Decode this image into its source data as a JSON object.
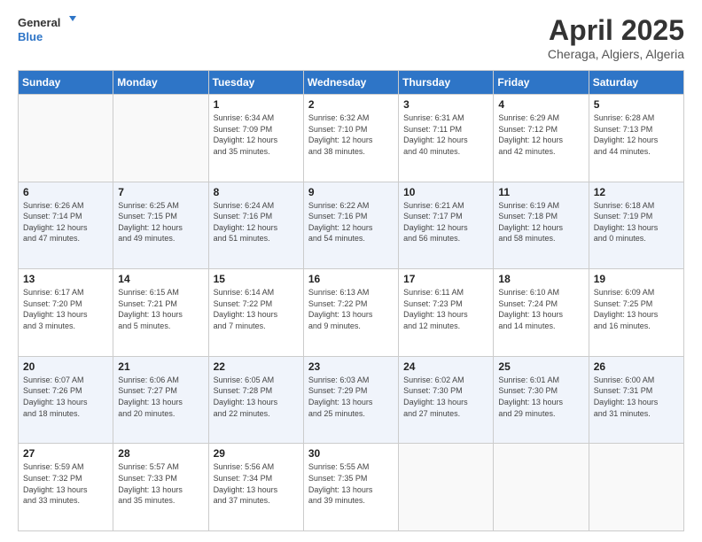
{
  "header": {
    "logo_line1": "General",
    "logo_line2": "Blue",
    "month": "April 2025",
    "location": "Cheraga, Algiers, Algeria"
  },
  "weekdays": [
    "Sunday",
    "Monday",
    "Tuesday",
    "Wednesday",
    "Thursday",
    "Friday",
    "Saturday"
  ],
  "weeks": [
    [
      {
        "day": "",
        "info": ""
      },
      {
        "day": "",
        "info": ""
      },
      {
        "day": "1",
        "info": "Sunrise: 6:34 AM\nSunset: 7:09 PM\nDaylight: 12 hours\nand 35 minutes."
      },
      {
        "day": "2",
        "info": "Sunrise: 6:32 AM\nSunset: 7:10 PM\nDaylight: 12 hours\nand 38 minutes."
      },
      {
        "day": "3",
        "info": "Sunrise: 6:31 AM\nSunset: 7:11 PM\nDaylight: 12 hours\nand 40 minutes."
      },
      {
        "day": "4",
        "info": "Sunrise: 6:29 AM\nSunset: 7:12 PM\nDaylight: 12 hours\nand 42 minutes."
      },
      {
        "day": "5",
        "info": "Sunrise: 6:28 AM\nSunset: 7:13 PM\nDaylight: 12 hours\nand 44 minutes."
      }
    ],
    [
      {
        "day": "6",
        "info": "Sunrise: 6:26 AM\nSunset: 7:14 PM\nDaylight: 12 hours\nand 47 minutes."
      },
      {
        "day": "7",
        "info": "Sunrise: 6:25 AM\nSunset: 7:15 PM\nDaylight: 12 hours\nand 49 minutes."
      },
      {
        "day": "8",
        "info": "Sunrise: 6:24 AM\nSunset: 7:16 PM\nDaylight: 12 hours\nand 51 minutes."
      },
      {
        "day": "9",
        "info": "Sunrise: 6:22 AM\nSunset: 7:16 PM\nDaylight: 12 hours\nand 54 minutes."
      },
      {
        "day": "10",
        "info": "Sunrise: 6:21 AM\nSunset: 7:17 PM\nDaylight: 12 hours\nand 56 minutes."
      },
      {
        "day": "11",
        "info": "Sunrise: 6:19 AM\nSunset: 7:18 PM\nDaylight: 12 hours\nand 58 minutes."
      },
      {
        "day": "12",
        "info": "Sunrise: 6:18 AM\nSunset: 7:19 PM\nDaylight: 13 hours\nand 0 minutes."
      }
    ],
    [
      {
        "day": "13",
        "info": "Sunrise: 6:17 AM\nSunset: 7:20 PM\nDaylight: 13 hours\nand 3 minutes."
      },
      {
        "day": "14",
        "info": "Sunrise: 6:15 AM\nSunset: 7:21 PM\nDaylight: 13 hours\nand 5 minutes."
      },
      {
        "day": "15",
        "info": "Sunrise: 6:14 AM\nSunset: 7:22 PM\nDaylight: 13 hours\nand 7 minutes."
      },
      {
        "day": "16",
        "info": "Sunrise: 6:13 AM\nSunset: 7:22 PM\nDaylight: 13 hours\nand 9 minutes."
      },
      {
        "day": "17",
        "info": "Sunrise: 6:11 AM\nSunset: 7:23 PM\nDaylight: 13 hours\nand 12 minutes."
      },
      {
        "day": "18",
        "info": "Sunrise: 6:10 AM\nSunset: 7:24 PM\nDaylight: 13 hours\nand 14 minutes."
      },
      {
        "day": "19",
        "info": "Sunrise: 6:09 AM\nSunset: 7:25 PM\nDaylight: 13 hours\nand 16 minutes."
      }
    ],
    [
      {
        "day": "20",
        "info": "Sunrise: 6:07 AM\nSunset: 7:26 PM\nDaylight: 13 hours\nand 18 minutes."
      },
      {
        "day": "21",
        "info": "Sunrise: 6:06 AM\nSunset: 7:27 PM\nDaylight: 13 hours\nand 20 minutes."
      },
      {
        "day": "22",
        "info": "Sunrise: 6:05 AM\nSunset: 7:28 PM\nDaylight: 13 hours\nand 22 minutes."
      },
      {
        "day": "23",
        "info": "Sunrise: 6:03 AM\nSunset: 7:29 PM\nDaylight: 13 hours\nand 25 minutes."
      },
      {
        "day": "24",
        "info": "Sunrise: 6:02 AM\nSunset: 7:30 PM\nDaylight: 13 hours\nand 27 minutes."
      },
      {
        "day": "25",
        "info": "Sunrise: 6:01 AM\nSunset: 7:30 PM\nDaylight: 13 hours\nand 29 minutes."
      },
      {
        "day": "26",
        "info": "Sunrise: 6:00 AM\nSunset: 7:31 PM\nDaylight: 13 hours\nand 31 minutes."
      }
    ],
    [
      {
        "day": "27",
        "info": "Sunrise: 5:59 AM\nSunset: 7:32 PM\nDaylight: 13 hours\nand 33 minutes."
      },
      {
        "day": "28",
        "info": "Sunrise: 5:57 AM\nSunset: 7:33 PM\nDaylight: 13 hours\nand 35 minutes."
      },
      {
        "day": "29",
        "info": "Sunrise: 5:56 AM\nSunset: 7:34 PM\nDaylight: 13 hours\nand 37 minutes."
      },
      {
        "day": "30",
        "info": "Sunrise: 5:55 AM\nSunset: 7:35 PM\nDaylight: 13 hours\nand 39 minutes."
      },
      {
        "day": "",
        "info": ""
      },
      {
        "day": "",
        "info": ""
      },
      {
        "day": "",
        "info": ""
      }
    ]
  ]
}
